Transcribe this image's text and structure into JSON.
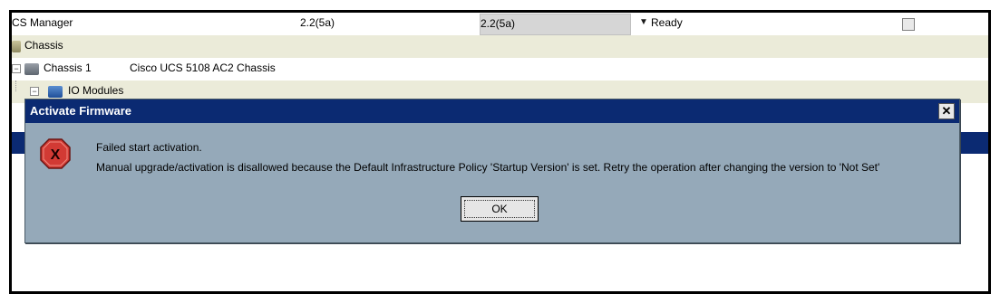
{
  "table": {
    "ucs_manager": {
      "name": "CS Manager",
      "running_version": "2.2(5a)",
      "startup_version": "2.2(5a)",
      "status": "Ready"
    },
    "chassis_root": {
      "label": "Chassis"
    },
    "chassis1": {
      "label": "Chassis 1",
      "model": "Cisco UCS 5108 AC2 Chassis"
    },
    "io_modules": {
      "label": "IO Modules"
    }
  },
  "dialog": {
    "title": "Activate Firmware",
    "close_glyph": "✕",
    "message_line1": "Failed start activation.",
    "message_line2": "Manual upgrade/activation is disallowed because the Default Infrastructure Policy 'Startup Version' is set. Retry the operation after changing the version to 'Not Set'",
    "ok_label": "OK",
    "error_icon_glyph": "X"
  },
  "colors": {
    "title_bar": "#0b2a72",
    "dialog_bg": "#95a9b9",
    "alt_row": "#ebebd9",
    "error_icon": "#d23a34"
  }
}
